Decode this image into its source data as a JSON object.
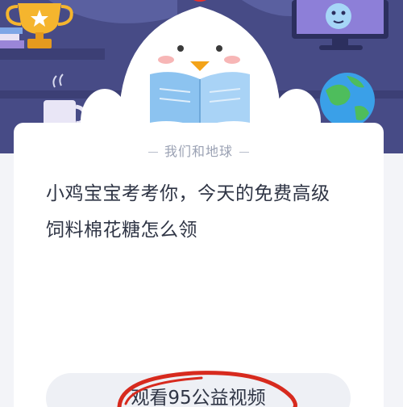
{
  "header": {
    "illustration": "chick-mascot-reading-book",
    "decorations": [
      "trophy-icon",
      "books-icon",
      "mug-icon",
      "monitor-icon",
      "globe-icon"
    ],
    "colors": {
      "background": "#474b86",
      "mascot": "#ffffff",
      "book": "#8cc3f0",
      "comb": "#e8312c"
    }
  },
  "card": {
    "category": "我们和地球",
    "question_line1": "小鸡宝宝考考你，今天的免费高级",
    "question_line2": "饲料棉花糖怎么领",
    "option_label": "观看95公益视频"
  },
  "annotation": {
    "shape": "hand-drawn-ellipse",
    "color": "#d72a1e"
  }
}
